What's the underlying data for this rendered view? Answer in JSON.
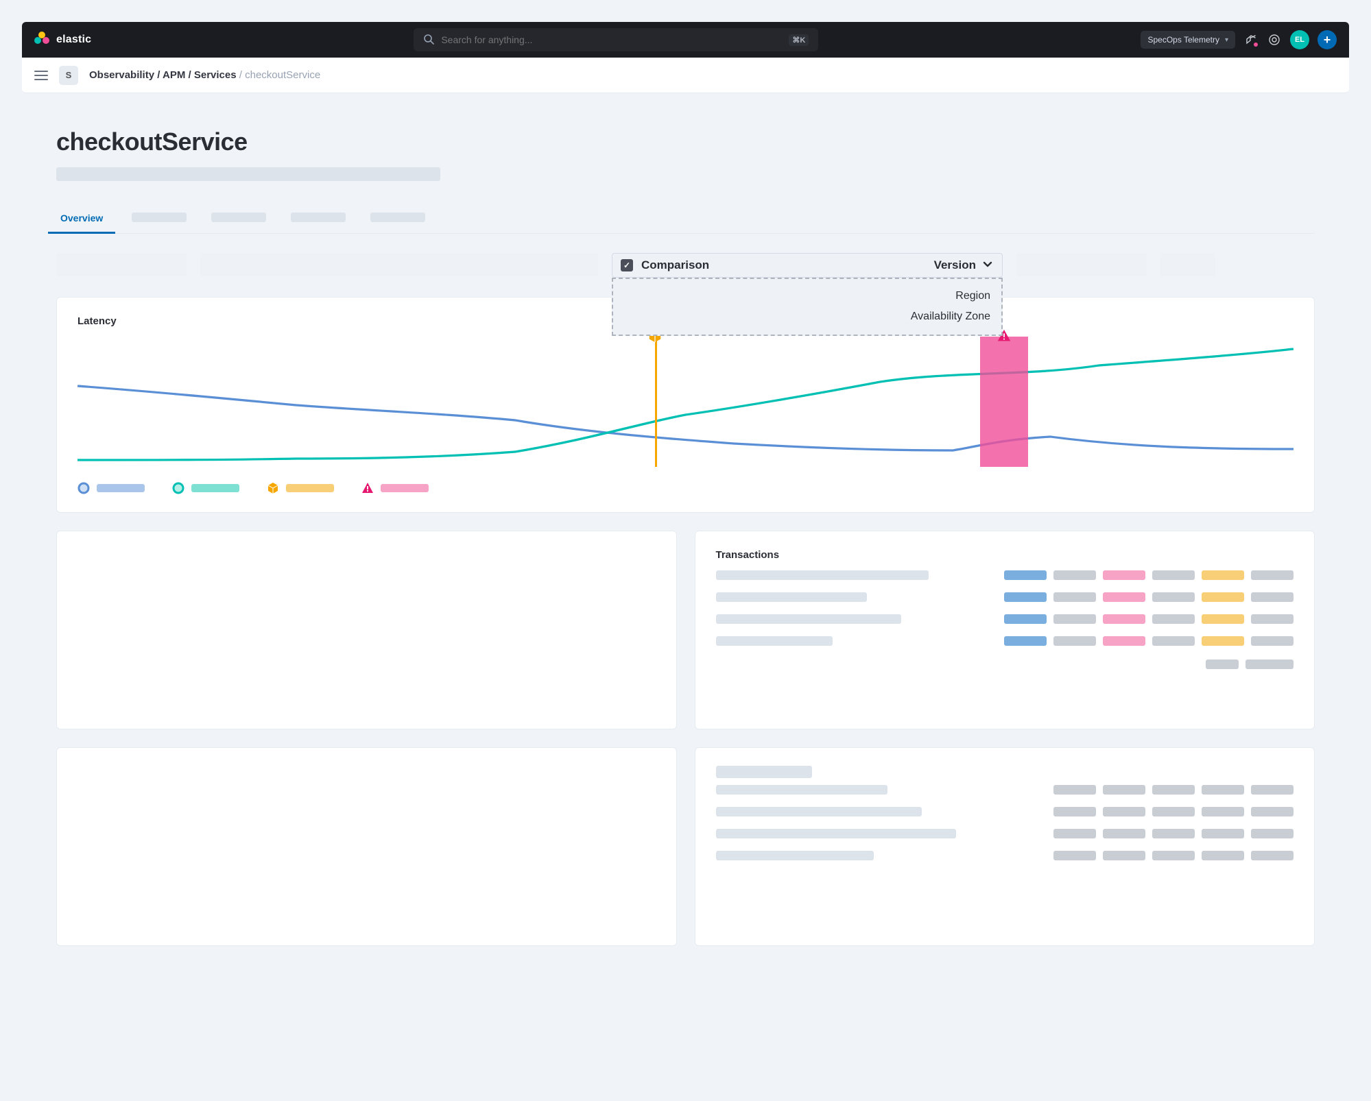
{
  "brand": {
    "name": "elastic"
  },
  "search": {
    "placeholder": "Search for anything...",
    "shortcut": "⌘K"
  },
  "header": {
    "deployment_label": "SpecOps Telemetry",
    "avatar_initials": "EL"
  },
  "breadcrumb": {
    "space_initial": "S",
    "parts": [
      "Observability",
      "APM",
      "Services"
    ],
    "current": "checkoutService"
  },
  "page": {
    "title": "checkoutService"
  },
  "tabs": {
    "active": "Overview"
  },
  "comparison": {
    "label": "Comparison",
    "selected": "Version",
    "options": [
      "Region",
      "Availability Zone"
    ]
  },
  "latency_panel": {
    "title": "Latency"
  },
  "transactions_panel": {
    "title": "Transactions"
  },
  "chart_data": {
    "type": "line",
    "title": "Latency",
    "xlabel": "",
    "ylabel": "",
    "xlim": [
      0,
      1000
    ],
    "ylim": [
      0,
      100
    ],
    "annotations": [
      {
        "kind": "vertical_line",
        "x": 475,
        "color": "#f5a700",
        "icon": "package"
      },
      {
        "kind": "band",
        "x0": 742,
        "x1": 782,
        "color": "#f04e98",
        "icon": "alert"
      }
    ],
    "series": [
      {
        "name": "series-blue",
        "color": "#5a8fd6",
        "x": [
          0,
          60,
          120,
          180,
          240,
          300,
          360,
          420,
          480,
          540,
          600,
          660,
          720,
          760,
          800,
          860,
          920,
          1000
        ],
        "y": [
          62,
          56,
          52,
          47,
          42,
          40,
          35,
          25,
          22,
          18,
          14,
          12,
          11,
          18,
          22,
          14,
          12,
          12
        ]
      },
      {
        "name": "series-teal",
        "color": "#00bfb3",
        "x": [
          0,
          60,
          120,
          180,
          240,
          300,
          360,
          420,
          460,
          500,
          540,
          600,
          660,
          720,
          780,
          840,
          900,
          960,
          1000
        ],
        "y": [
          5,
          5,
          5,
          6,
          6,
          8,
          12,
          22,
          32,
          40,
          45,
          55,
          66,
          74,
          70,
          78,
          82,
          86,
          90
        ]
      }
    ],
    "legend": [
      {
        "marker": "circle",
        "color": "#5a8fd6",
        "swatch": "#a9c6ea"
      },
      {
        "marker": "circle",
        "color": "#00bfb3",
        "swatch": "#7ee0d3"
      },
      {
        "marker": "package",
        "color": "#f5a700",
        "swatch": "#f8cf76"
      },
      {
        "marker": "alert",
        "color": "#e7186f",
        "swatch": "#f6a3c5"
      }
    ]
  }
}
